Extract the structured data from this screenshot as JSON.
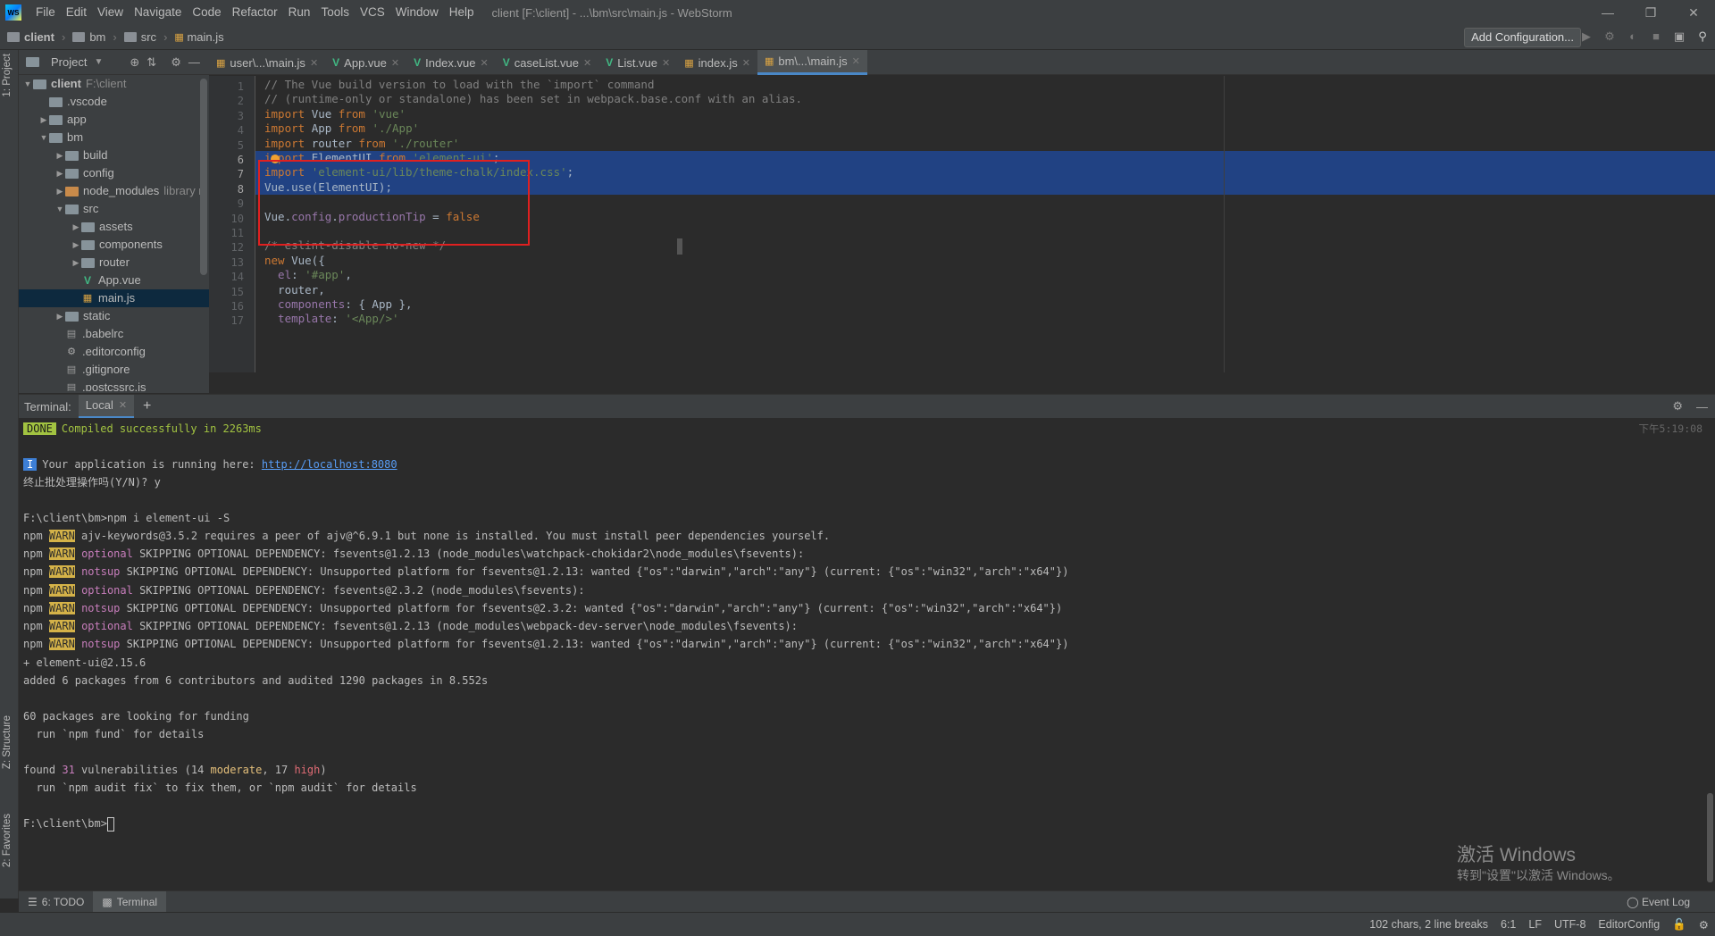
{
  "app": {
    "logo_text": "WS",
    "window_title": "client [F:\\client] - ...\\bm\\src\\main.js - WebStorm",
    "menu": [
      "File",
      "Edit",
      "View",
      "Navigate",
      "Code",
      "Refactor",
      "Run",
      "Tools",
      "VCS",
      "Window",
      "Help"
    ]
  },
  "breadcrumb": [
    "client",
    "bm",
    "src",
    "main.js"
  ],
  "toolbar": {
    "add_configuration": "Add Configuration..."
  },
  "project": {
    "title": "Project",
    "tree": [
      {
        "label": "client",
        "extra": "F:\\client",
        "depth": 0,
        "type": "folder",
        "expanded": true,
        "bold": true
      },
      {
        "label": ".vscode",
        "depth": 1,
        "type": "folder",
        "expanded": null
      },
      {
        "label": "app",
        "depth": 1,
        "type": "folder",
        "expanded": false
      },
      {
        "label": "bm",
        "depth": 1,
        "type": "folder",
        "expanded": true
      },
      {
        "label": "build",
        "depth": 2,
        "type": "folder",
        "expanded": false
      },
      {
        "label": "config",
        "depth": 2,
        "type": "folder",
        "expanded": false
      },
      {
        "label": "node_modules",
        "extra": "library r",
        "depth": 2,
        "type": "folder-excluded",
        "expanded": false
      },
      {
        "label": "src",
        "depth": 2,
        "type": "folder",
        "expanded": true
      },
      {
        "label": "assets",
        "depth": 3,
        "type": "folder",
        "expanded": false
      },
      {
        "label": "components",
        "depth": 3,
        "type": "folder",
        "expanded": false
      },
      {
        "label": "router",
        "depth": 3,
        "type": "folder",
        "expanded": false
      },
      {
        "label": "App.vue",
        "depth": 3,
        "type": "vue"
      },
      {
        "label": "main.js",
        "depth": 3,
        "type": "js",
        "selected": true
      },
      {
        "label": "static",
        "depth": 2,
        "type": "folder",
        "expanded": false
      },
      {
        "label": ".babelrc",
        "depth": 2,
        "type": "config"
      },
      {
        "label": ".editorconfig",
        "depth": 2,
        "type": "gear"
      },
      {
        "label": ".gitignore",
        "depth": 2,
        "type": "config"
      },
      {
        "label": ".postcssrc.js",
        "depth": 2,
        "type": "config"
      }
    ]
  },
  "editor_tabs": [
    {
      "label": "user\\...\\main.js",
      "icon": "js",
      "active": false
    },
    {
      "label": "App.vue",
      "icon": "vue",
      "active": false
    },
    {
      "label": "Index.vue",
      "icon": "vue",
      "active": false
    },
    {
      "label": "caseList.vue",
      "icon": "vue",
      "active": false
    },
    {
      "label": "List.vue",
      "icon": "vue",
      "active": false
    },
    {
      "label": "index.js",
      "icon": "js",
      "active": false
    },
    {
      "label": "bm\\...\\main.js",
      "icon": "js",
      "active": true
    }
  ],
  "code": [
    {
      "n": "1",
      "parts": [
        [
          "cm",
          "// The Vue build version to load with the `import` command"
        ]
      ]
    },
    {
      "n": "2",
      "parts": [
        [
          "cm",
          "// (runtime-only or standalone) has been set in webpack.base.conf with an alias."
        ]
      ]
    },
    {
      "n": "3",
      "parts": [
        [
          "kw",
          "import "
        ],
        [
          "",
          "Vue "
        ],
        [
          "kw",
          "from "
        ],
        [
          "str",
          "'vue'"
        ]
      ]
    },
    {
      "n": "4",
      "parts": [
        [
          "kw",
          "import "
        ],
        [
          "",
          "App "
        ],
        [
          "kw",
          "from "
        ],
        [
          "str",
          "'./App'"
        ]
      ]
    },
    {
      "n": "5",
      "parts": [
        [
          "kw",
          "import "
        ],
        [
          "",
          "router "
        ],
        [
          "kw",
          "from "
        ],
        [
          "str",
          "'./router'"
        ]
      ]
    },
    {
      "n": "6",
      "parts": [
        [
          "kw",
          "import "
        ],
        [
          "",
          "ElementUI "
        ],
        [
          "kw",
          "from "
        ],
        [
          "str",
          "'element-ui'"
        ],
        [
          "",
          ";"
        ]
      ],
      "selected": true
    },
    {
      "n": "7",
      "parts": [
        [
          "kw",
          "import "
        ],
        [
          "str",
          "'element-ui/lib/theme-chalk/index.css'"
        ],
        [
          "",
          ";"
        ]
      ],
      "selected": true
    },
    {
      "n": "8",
      "parts": [
        [
          "",
          "Vue.use(ElementUI);"
        ]
      ],
      "selected": true
    },
    {
      "n": "9",
      "parts": [
        [
          "",
          ""
        ]
      ]
    },
    {
      "n": "10",
      "parts": [
        [
          "",
          "Vue."
        ],
        [
          "prop",
          "config"
        ],
        [
          "",
          "."
        ],
        [
          "prop",
          "productionTip "
        ],
        [
          "",
          "= "
        ],
        [
          "kw",
          "false"
        ]
      ]
    },
    {
      "n": "11",
      "parts": [
        [
          "",
          ""
        ]
      ]
    },
    {
      "n": "12",
      "parts": [
        [
          "cm",
          "/* eslint-disable no-new */"
        ]
      ]
    },
    {
      "n": "13",
      "parts": [
        [
          "kw",
          "new "
        ],
        [
          "",
          "Vue({"
        ]
      ]
    },
    {
      "n": "14",
      "parts": [
        [
          "prop",
          "  el"
        ],
        [
          "",
          ": "
        ],
        [
          "str",
          "'#app'"
        ],
        [
          "",
          ","
        ]
      ]
    },
    {
      "n": "15",
      "parts": [
        [
          "",
          "  router,"
        ]
      ]
    },
    {
      "n": "16",
      "parts": [
        [
          "prop",
          "  components"
        ],
        [
          "",
          ": { App },"
        ]
      ]
    },
    {
      "n": "17",
      "parts": [
        [
          "prop",
          "  template"
        ],
        [
          "",
          ": "
        ],
        [
          "str",
          "'<App/>'"
        ]
      ]
    }
  ],
  "terminal": {
    "label": "Terminal:",
    "tab": "Local",
    "timestamp": "下午5:19:08",
    "done_badge": "DONE",
    "compiled": "Compiled successfully in 2263ms",
    "info_badge": "I",
    "running_prefix": "Your application is running here: ",
    "running_url": "http://localhost:8080",
    "prompt_cn": "终止批处理操作吗(Y/N)? y",
    "cmd": "F:\\client\\bm>npm i element-ui -S",
    "npm": "npm",
    "warn": "WARN",
    "warnings": [
      {
        "kind": "",
        "text": " ajv-keywords@3.5.2 requires a peer of ajv@^6.9.1 but none is installed. You must install peer dependencies yourself."
      },
      {
        "kind": "optional",
        "text": " SKIPPING OPTIONAL DEPENDENCY: fsevents@1.2.13 (node_modules\\watchpack-chokidar2\\node_modules\\fsevents):"
      },
      {
        "kind": "notsup",
        "text": " SKIPPING OPTIONAL DEPENDENCY: Unsupported platform for fsevents@1.2.13: wanted {\"os\":\"darwin\",\"arch\":\"any\"} (current: {\"os\":\"win32\",\"arch\":\"x64\"})"
      },
      {
        "kind": "optional",
        "text": " SKIPPING OPTIONAL DEPENDENCY: fsevents@2.3.2 (node_modules\\fsevents):"
      },
      {
        "kind": "notsup",
        "text": " SKIPPING OPTIONAL DEPENDENCY: Unsupported platform for fsevents@2.3.2: wanted {\"os\":\"darwin\",\"arch\":\"any\"} (current: {\"os\":\"win32\",\"arch\":\"x64\"})"
      },
      {
        "kind": "optional",
        "text": " SKIPPING OPTIONAL DEPENDENCY: fsevents@1.2.13 (node_modules\\webpack-dev-server\\node_modules\\fsevents):"
      },
      {
        "kind": "notsup",
        "text": " SKIPPING OPTIONAL DEPENDENCY: Unsupported platform for fsevents@1.2.13: wanted {\"os\":\"darwin\",\"arch\":\"any\"} (current: {\"os\":\"win32\",\"arch\":\"x64\"})"
      }
    ],
    "added_pkg": "+ element-ui@2.15.6",
    "added_summary": "added 6 packages from 6 contributors and audited 1290 packages in 8.552s",
    "funding": "60 packages are looking for funding",
    "funding_hint": "  run `npm fund` for details",
    "vuln_prefix": "found ",
    "vuln_count": "31",
    "vuln_mid": " vulnerabilities (14 ",
    "vuln_moderate": "moderate",
    "vuln_sep": ", 17 ",
    "vuln_high": "high",
    "vuln_end": ")",
    "audit_hint": "  run `npm audit fix` to fix them, or `npm audit` for details",
    "final_prompt": "F:\\client\\bm>"
  },
  "watermark": {
    "title": "激活 Windows",
    "subtitle": "转到\"设置\"以激活 Windows。"
  },
  "stripes": {
    "project": "1: Project",
    "structure": "Z: Structure",
    "favorites": "2: Favorites"
  },
  "tool_tabs": {
    "todo": "6: TODO",
    "terminal": "Terminal",
    "event_log": "Event Log"
  },
  "status": {
    "selection": "102 chars, 2 line breaks",
    "position": "6:1",
    "line_sep": "LF",
    "encoding": "UTF-8",
    "config": "EditorConfig"
  }
}
